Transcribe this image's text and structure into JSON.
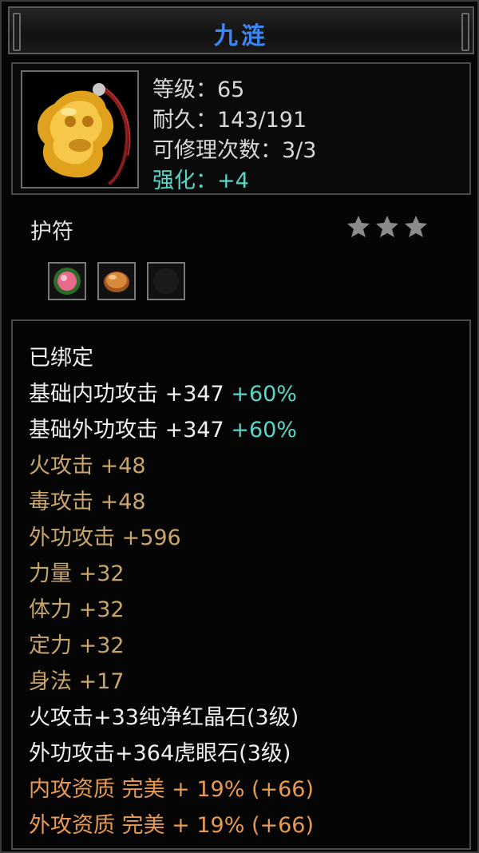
{
  "item": {
    "name": "九涟",
    "level_line": "等级：65",
    "durability_line": "耐久：143/191",
    "repair_line": "可修理次数：3/3",
    "enhance_line": "强化：+4",
    "type": "护符",
    "star_count": 3,
    "gem_slots": [
      "pink-gem-icon",
      "amber-gem-icon",
      "empty-slot"
    ]
  },
  "attributes": {
    "bound": "已绑定",
    "base_inner": {
      "label": "基础内功攻击 +347 ",
      "bonus": "+60%"
    },
    "base_outer": {
      "label": "基础外功攻击 +347 ",
      "bonus": "+60%"
    },
    "fire_attack": "火攻击 +48",
    "poison_attack": "毒攻击 +48",
    "outer_attack": "外功攻击 +596",
    "strength": "力量 +32",
    "stamina": "体力 +32",
    "focus": "定力 +32",
    "agility": "身法 +17",
    "gem_fire": "火攻击+33纯净红晶石(3级)",
    "gem_outer": "外功攻击+364虎眼石(3级)",
    "inner_quality": "内攻资质  完美  + 19% (+66)",
    "outer_quality": "外攻资质  完美  + 19% (+66)"
  },
  "colors": {
    "title": "#3d86f0",
    "bonus": "#58d6c7",
    "stat": "#c8a56a",
    "quality": "#e79a52"
  }
}
